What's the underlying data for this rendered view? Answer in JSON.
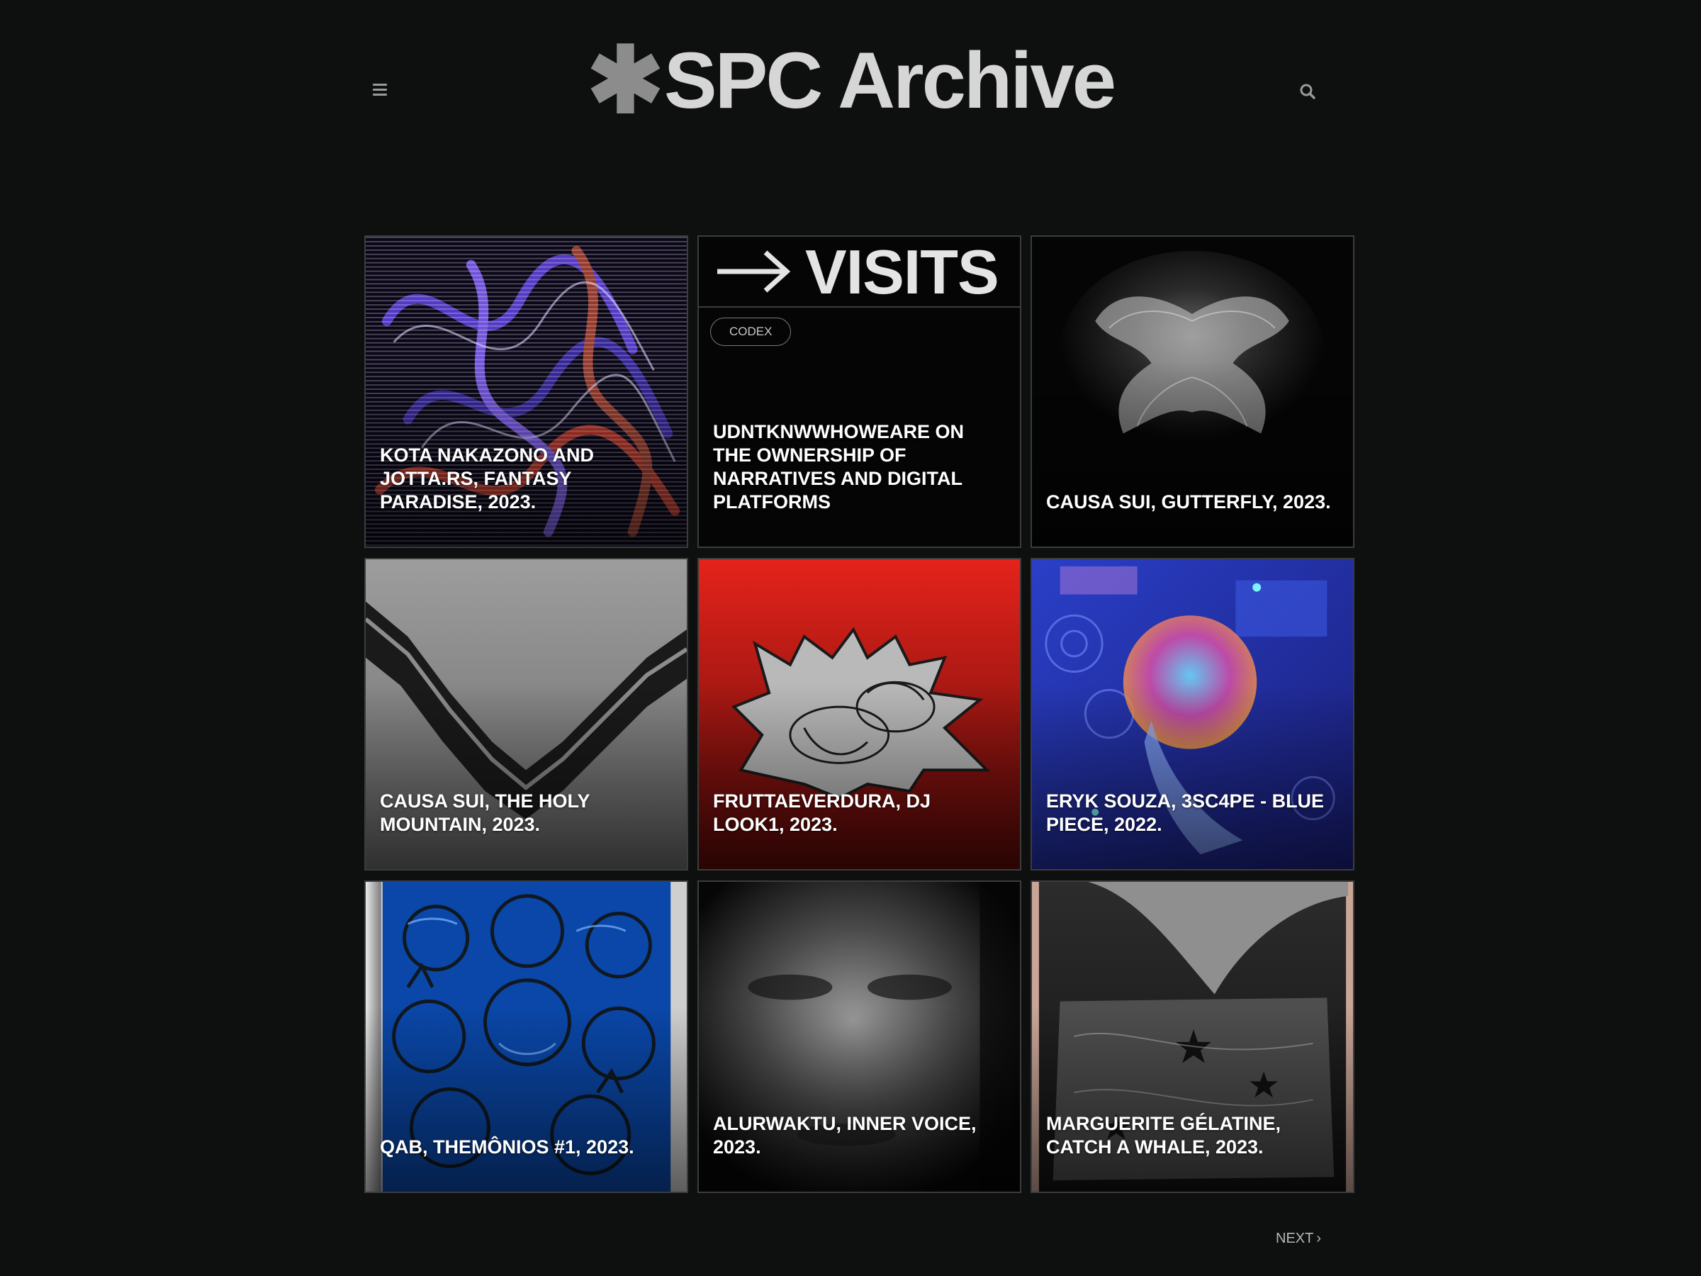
{
  "header": {
    "logo_mark": "✱",
    "logo_text": "SPC Archive",
    "menu_icon": "hamburger-menu-icon",
    "search_icon": "search-icon"
  },
  "cards": [
    {
      "caption": "KOTA NAKAZONO AND JOTTA.RS, FANTASY PARADISE, 2023."
    },
    {
      "heading": "VISITS",
      "heading_icon": "arrow-right-icon",
      "tag": "CODEX",
      "caption": "UDNTKNWWHOWEARE ON THE OWNERSHIP OF NARRATIVES AND DIGITAL PLATFORMS"
    },
    {
      "caption": "CAUSA SUI, GUTTERFLY, 2023."
    },
    {
      "caption": "CAUSA SUI, THE HOLY MOUNTAIN, 2023."
    },
    {
      "caption": "FRUTTAEVERDURA, DJ LOOK1, 2023."
    },
    {
      "caption": "ERYK SOUZA, 3SC4PE - BLUE PIECE, 2022."
    },
    {
      "caption": "QAB, THEMÔNIOS #1, 2023."
    },
    {
      "caption": "ALURWAKTU, INNER VOICE, 2023."
    },
    {
      "caption": "MARGUERITE GÉLATINE, CATCH A WHALE, 2023."
    }
  ],
  "pagination": {
    "next_label": "NEXT",
    "next_icon": "chevron-right-icon"
  },
  "colors": {
    "background": "#0e0f0f",
    "logo": "#d6d6d6",
    "card_border": "#3c3c3c",
    "accent_red": "#e4231b"
  }
}
